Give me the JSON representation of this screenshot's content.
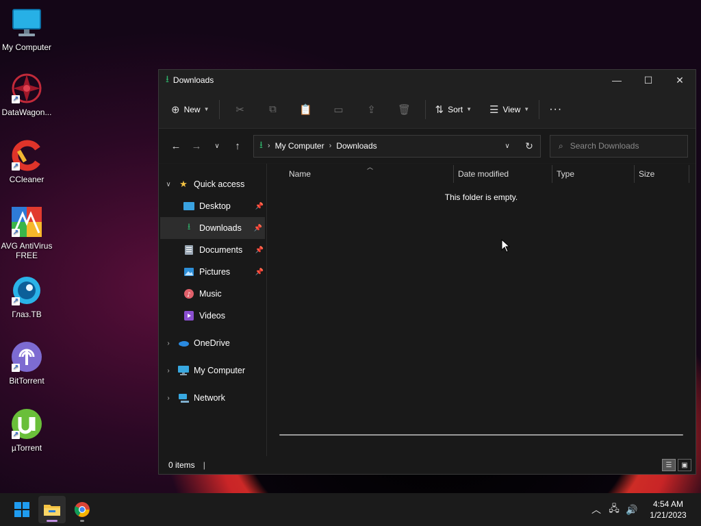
{
  "desktop": {
    "icons": [
      {
        "label": "My Computer",
        "icon": "monitor-icon"
      },
      {
        "label": "DataWagon...",
        "icon": "datawagon-icon"
      },
      {
        "label": "CCleaner",
        "icon": "ccleaner-icon"
      },
      {
        "label": "AVG AntiVirus FREE",
        "icon": "avg-icon"
      },
      {
        "label": "Глаз.ТВ",
        "icon": "glaz-tv-icon"
      },
      {
        "label": "BitTorrent",
        "icon": "bittorrent-icon"
      },
      {
        "label": "µTorrent",
        "icon": "utorrent-icon"
      }
    ]
  },
  "window": {
    "title": "Downloads",
    "toolbar": {
      "new_label": "New",
      "sort_label": "Sort",
      "view_label": "View",
      "more_label": "···"
    },
    "address": {
      "crumbs": [
        "My Computer",
        "Downloads"
      ]
    },
    "search": {
      "placeholder": "Search Downloads"
    },
    "sidebar": {
      "quick_access": "Quick access",
      "items": [
        {
          "label": "Desktop",
          "icon": "desktop-icon",
          "pinned": true
        },
        {
          "label": "Downloads",
          "icon": "download-icon",
          "pinned": true,
          "selected": true
        },
        {
          "label": "Documents",
          "icon": "document-icon",
          "pinned": true
        },
        {
          "label": "Pictures",
          "icon": "pictures-icon",
          "pinned": true
        },
        {
          "label": "Music",
          "icon": "music-icon",
          "pinned": false
        },
        {
          "label": "Videos",
          "icon": "videos-icon",
          "pinned": false
        }
      ],
      "roots": [
        {
          "label": "OneDrive",
          "icon": "cloud-icon"
        },
        {
          "label": "My Computer",
          "icon": "computer-icon"
        },
        {
          "label": "Network",
          "icon": "network-icon"
        }
      ]
    },
    "columns": [
      "Name",
      "Date modified",
      "Type",
      "Size"
    ],
    "empty_message": "This folder is empty.",
    "status": {
      "items": "0 items"
    }
  },
  "taskbar": {
    "clock_time": "4:54 AM",
    "clock_date": "1/21/2023"
  },
  "colors": {
    "accent_green": "#2fb36b",
    "folder_yellow": "#f6c443",
    "win_blue": "#1f9cf0"
  }
}
